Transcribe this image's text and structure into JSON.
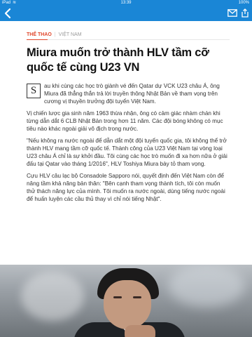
{
  "status_bar": {
    "carrier": "iPad",
    "time": "13:39",
    "battery": "100%"
  },
  "toolbar": {
    "back_icon": "chevron-left-icon",
    "mail_icon": "mail-icon",
    "share_icon": "share-icon"
  },
  "article": {
    "category": "THỂ THAO",
    "subcategory": "VIỆT NAM",
    "title": "Miura muốn trở thành HLV tầm cỡ quốc tế cùng U23 VN",
    "dropcap": "S",
    "lead": "au khi cùng các học trò giành vé đến Qatar dự VCK U23 châu Á, ông Miura đã thẳng thắn trả lời truyền thông Nhật Bản về tham vọng trên cương vị thuyền trưởng đội tuyển Việt Nam.",
    "paragraphs": [
      "Vị chiến lược gia sinh năm 1963 thừa nhận, ông có cảm giác nhàm chán khi từng dẫn dắt 6 CLB Nhật Bản trong hơn 11 năm. Các đội bóng không có mục tiêu nào khác ngoài giải vô địch trong nước.",
      "\"Nếu không ra nước ngoài để dẫn dắt một đội tuyển quốc gia, tôi không thể trở thành HLV mang tầm cỡ quốc tế. Thành công của U23 Việt Nam tại vòng loại U23 châu Á chỉ là sự khởi đầu. Tôi cùng các học trò muốn đi xa hơn nữa ở giải đấu tại Qatar vào tháng 1/2016\", HLV Toshiya Miura bày tỏ tham vọng.",
      "Cựu HLV câu lạc bộ Consadole Sapporo nói, quyết định đến Việt Nam còn để nâng tầm khả năng bản thân: \"Bên cạnh tham vọng thành tích, tôi còn muốn thử thách năng lực của mình. Tôi muốn ra nước ngoài, dùng tiếng nước ngoài để huấn luyện các cầu thủ thay vì chỉ nói tiếng Nhật\"."
    ]
  }
}
